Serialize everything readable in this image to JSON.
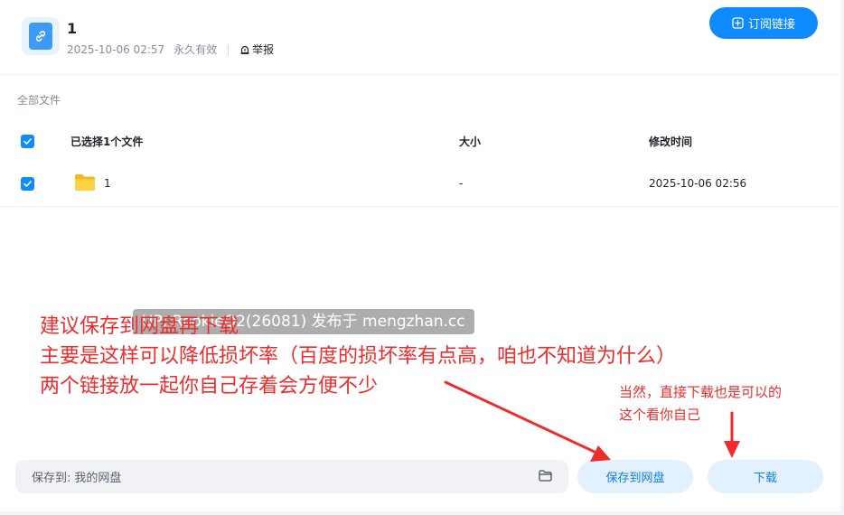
{
  "header": {
    "title": "1",
    "date": "2025-10-06 02:57",
    "validity": "永久有效",
    "report_label": "举报",
    "subscribe_label": "订阅链接"
  },
  "files": {
    "breadcrumb": "全部文件",
    "columns": {
      "selected": "已选择1个文件",
      "size": "大小",
      "modified": "修改时间"
    },
    "rows": [
      {
        "name": "1",
        "size": "-",
        "modified": "2025-10-06 02:56",
        "checked": true
      }
    ]
  },
  "bottom": {
    "save_to_label": "保存到:",
    "save_to_value": "我的网盘",
    "save_button": "保存到网盘",
    "download_button": "下载"
  },
  "overlay": {
    "watermark": "UP: RookieQ2(26081) 发布于 mengzhan.cc",
    "annotation_lines": [
      "建议保存到网盘再下载",
      "主要是这样可以降低损坏率（百度的损坏率有点高，咱也不知道为什么）",
      "两个链接放一起你自己存着会方便不少"
    ],
    "annotation_small_lines": [
      "当然，直接下载也是可以的",
      "这个看你自己"
    ]
  },
  "colors": {
    "accent": "#0f8bff",
    "accent_light": "#e3f1ff",
    "annotation_red": "#ef2b2b"
  }
}
